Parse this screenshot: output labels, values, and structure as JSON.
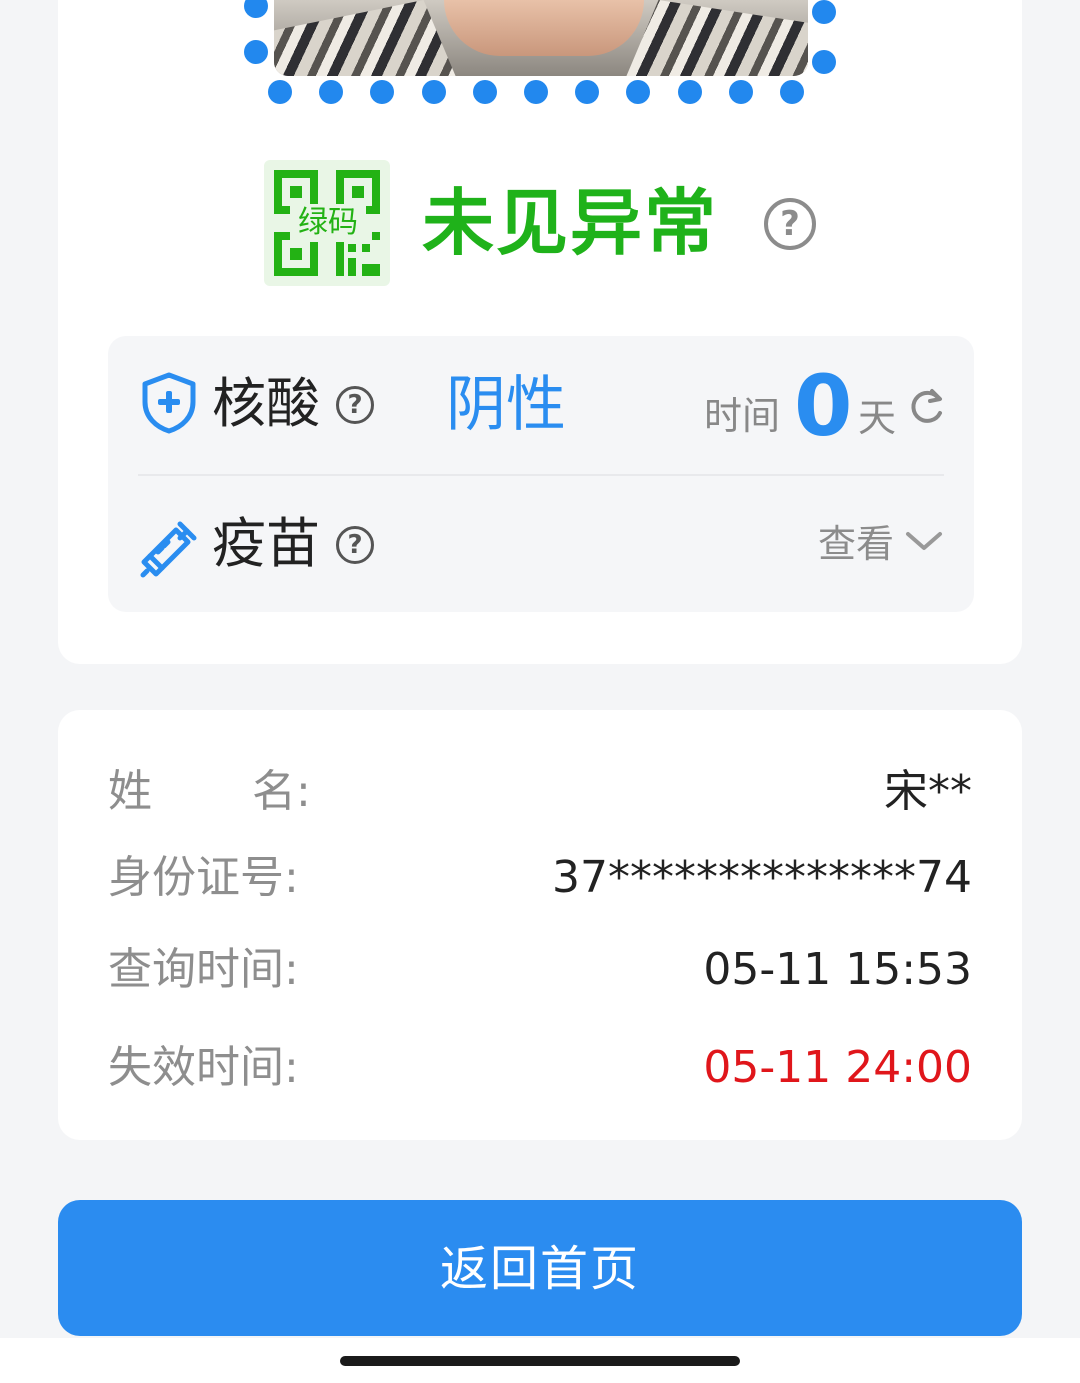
{
  "status": {
    "code_label": "绿码",
    "text": "未见异常",
    "help": "?",
    "colors": {
      "green": "#1fb21a",
      "blue": "#2a8df0",
      "red": "#e0161b"
    }
  },
  "nucleic": {
    "label": "核酸",
    "icon": "shield-plus-icon",
    "help": "?",
    "result": "阴性",
    "time_label": "时间",
    "days": "0",
    "unit": "天"
  },
  "vaccine": {
    "label": "疫苗",
    "icon": "syringe-icon",
    "help": "?",
    "view_label": "查看"
  },
  "details": {
    "name_label_a": "姓",
    "name_label_b": "名:",
    "name_value": "宋**",
    "id_label": "身份证号:",
    "id_value": "37**************74",
    "query_label": "查询时间:",
    "query_value": "05-11 15:53",
    "expire_label": "失效时间:",
    "expire_value": "05-11 24:00"
  },
  "button": {
    "home_label": "返回首页"
  }
}
